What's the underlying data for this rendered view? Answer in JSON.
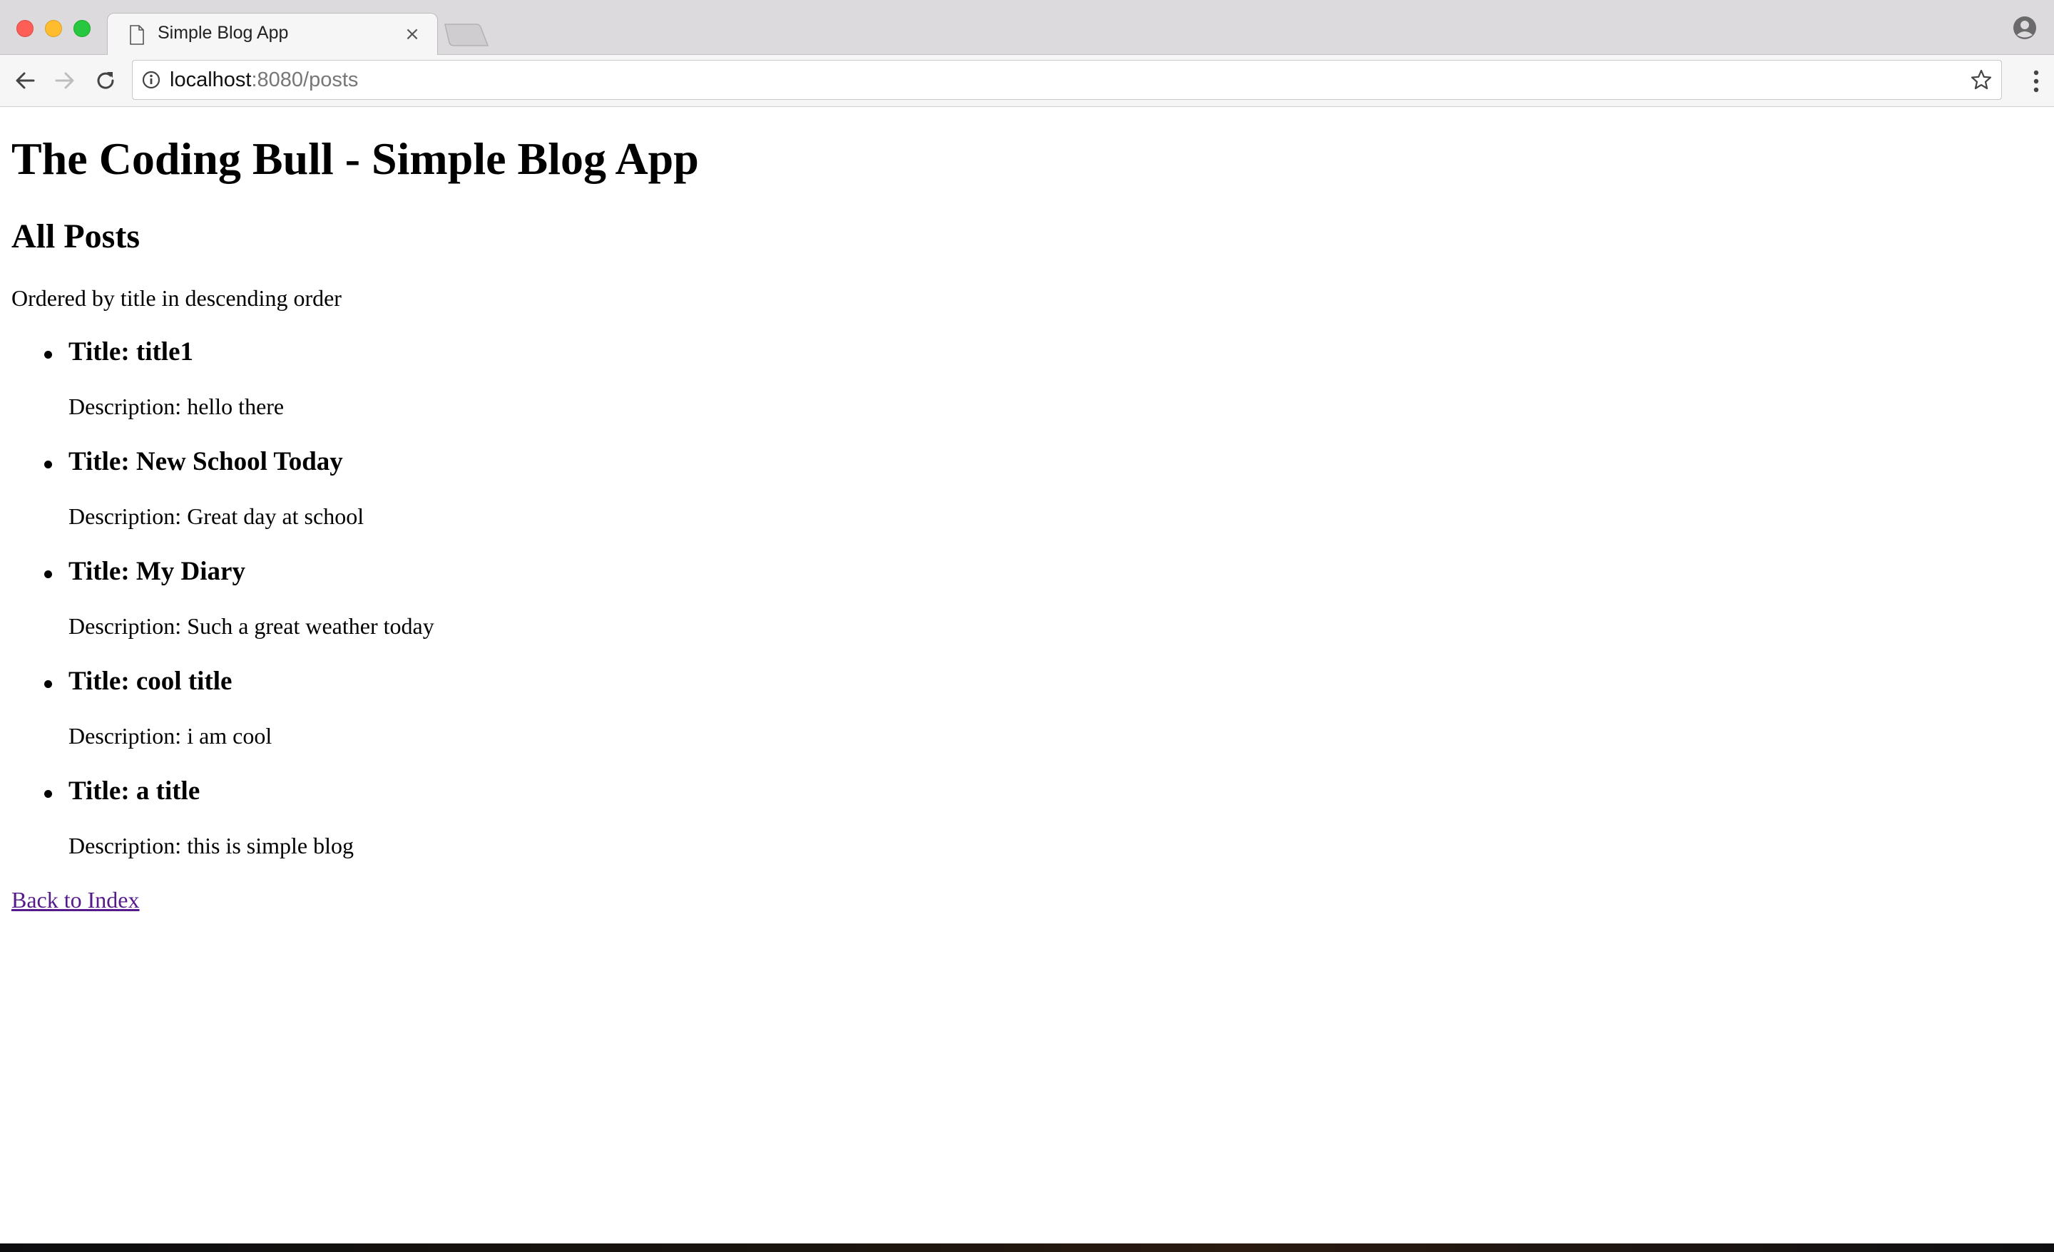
{
  "browser": {
    "tab_title": "Simple Blog App",
    "tab_close_glyph": "×",
    "url_host": "localhost",
    "url_path": ":8080/posts",
    "icons": [
      "close-window-icon",
      "minimize-window-icon",
      "maximize-window-icon",
      "page-icon",
      "tab-close-icon",
      "new-tab-icon",
      "profile-icon",
      "back-arrow-icon",
      "forward-arrow-icon",
      "reload-icon",
      "info-icon",
      "bookmark-star-icon",
      "more-menu-icon"
    ]
  },
  "page": {
    "heading": "The Coding Bull - Simple Blog App",
    "subheading": "All Posts",
    "ordering_note": "Ordered by title in descending order",
    "posts": [
      {
        "title": "Title: title1",
        "description": "Description: hello there"
      },
      {
        "title": "Title: New School Today",
        "description": "Description: Great day at school"
      },
      {
        "title": "Title: My Diary",
        "description": "Description: Such a great weather today"
      },
      {
        "title": "Title: cool title",
        "description": "Description: i am cool"
      },
      {
        "title": "Title: a title",
        "description": "Description: this is simple blog"
      }
    ],
    "back_link": "Back to Index"
  },
  "colors": {
    "visited_link": "#551a8b",
    "tab_strip": "#dcdadc",
    "toolbar": "#f6f6f6"
  }
}
